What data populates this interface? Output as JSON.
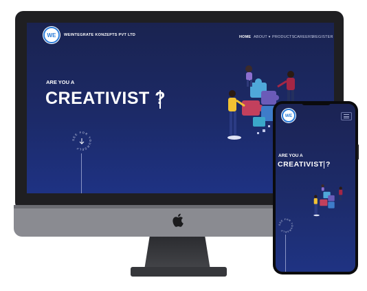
{
  "colors": {
    "screen_top": "#1a2350",
    "screen_bottom": "#1e3283",
    "logo_accent": "#2a7bd8",
    "puzzle_blue": "#4fa8d9",
    "puzzle_red": "#c2405d",
    "puzzle_purple": "#6b5bb8"
  },
  "desktop": {
    "brand": "WEINTEGRATE KONZEPTS PVT LTD",
    "logo_text": "WE",
    "nav": [
      {
        "label": "HOME",
        "active": true
      },
      {
        "label": "ABOUT ▾",
        "active": false
      },
      {
        "label": "PRODUCTS",
        "active": false
      },
      {
        "label": "CAREERS",
        "active": false
      },
      {
        "label": "REGISTER",
        "active": false
      }
    ],
    "hero_small": "ARE YOU A",
    "hero_big": "CREATIVIST ?",
    "scroll_badge_text": "SEE FOR YOURSELF",
    "scroll_icon": "arrow-down-icon"
  },
  "mobile": {
    "logo_text": "WE",
    "menu_icon": "hamburger-menu-icon",
    "hero_small": "ARE YOU A",
    "hero_big": "CREATIVIST ?",
    "scroll_badge_text": "SEE FOR YOURSELF"
  },
  "device_icons": {
    "apple_logo": "apple-logo-icon"
  }
}
